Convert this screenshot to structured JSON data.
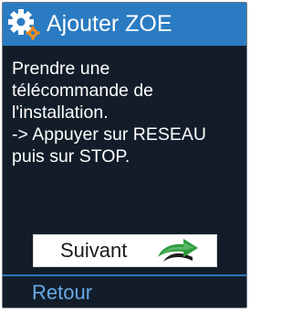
{
  "header": {
    "title": "Ajouter ZOE",
    "icon": "gear-icon"
  },
  "instructions": {
    "lines": [
      "Prendre une",
      "télécommande de",
      "l'installation.",
      "-> Appuyer sur RESEAU",
      "puis sur STOP."
    ]
  },
  "actions": {
    "next_label": "Suivant",
    "next_icon": "next-arrow-icon",
    "back_label": "Retour"
  },
  "colors": {
    "title_bar": "#2a7bc2",
    "background": "#121d29",
    "back_link": "#67a9e8",
    "arrow_green": "#2e9a3c"
  }
}
